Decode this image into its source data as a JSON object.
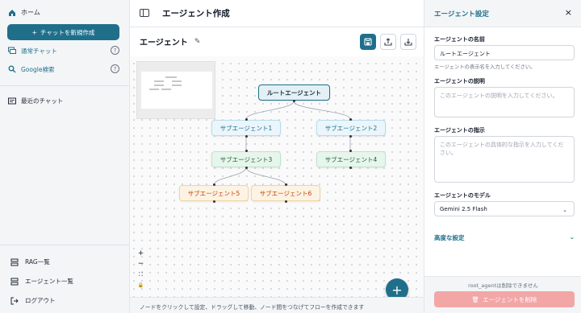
{
  "sidebar": {
    "home_label": "ホーム",
    "new_chat_label": "チャットを新規作成",
    "items": [
      {
        "label": "通常チャット",
        "icon": "chat-icon"
      },
      {
        "label": "Google検索",
        "icon": "search-icon"
      }
    ],
    "recent_label": "最近のチャット",
    "bottom": [
      {
        "label": "RAG一覧",
        "icon": "database-icon"
      },
      {
        "label": "エージェント一覧",
        "icon": "list-icon"
      },
      {
        "label": "ログアウト",
        "icon": "logout-icon"
      }
    ]
  },
  "topbar": {
    "title": "エージェント作成"
  },
  "canvas": {
    "agent_title": "エージェント",
    "nodes": {
      "root": "ルートエージェント",
      "sub1": "サブエージェント1",
      "sub2": "サブエージェント2",
      "sub3": "サブエージェント3",
      "sub4": "サブエージェント4",
      "sub5": "サブエージェント5",
      "sub6": "サブエージェント6"
    },
    "zoom_controls": [
      "+",
      "−",
      "⛶",
      "🔒"
    ],
    "footer_hint": "ノードをクリックして設定、ドラッグして移動、ノード間をつなげてフローを作成できます"
  },
  "panel": {
    "title": "エージェント設定",
    "name_label": "エージェントの名前",
    "name_value": "ルートエージェント",
    "name_hint": "エージェントの表示名を入力してください。",
    "desc_label": "エージェントの説明",
    "desc_placeholder": "このエージェントの説明を入力してください。",
    "instr_label": "エージェントの指示",
    "instr_placeholder": "このエージェントの具体的な指示を入力してください。",
    "model_label": "エージェントのモデル",
    "model_value": "Gemini 2.5 Flash",
    "advanced_label": "高度な設定",
    "delete_note": "root_agentは削除できません",
    "delete_label": "エージェントを削除"
  },
  "colors": {
    "accent": "#1f6f8b",
    "danger_disabled": "#f2a6a6"
  }
}
